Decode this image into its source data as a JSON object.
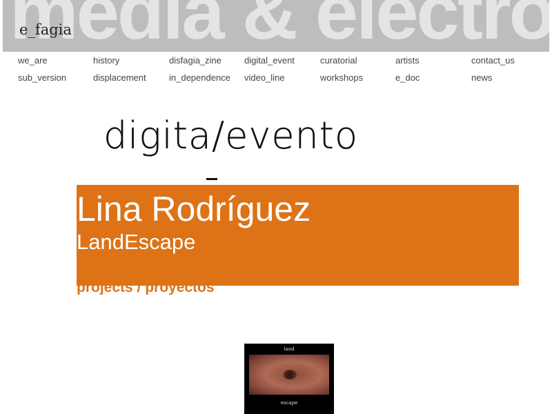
{
  "banner": {
    "background_text": "media & electronic",
    "logo": "e_fagia"
  },
  "nav": {
    "row1": [
      "we_are",
      "history",
      "disfagia_zine",
      "digital_event",
      "curatorial",
      "artists",
      "contact_us"
    ],
    "row2": [
      "sub_version",
      "displacement",
      "in_dependence",
      "video_line",
      "workshops",
      "e_doc",
      "news"
    ]
  },
  "section": {
    "title": "digita/evento"
  },
  "feature": {
    "artist": "Lina Rodríguez",
    "work": "LandEscape",
    "projects_label": "projects / proyectos",
    "accent_color": "#dd7316"
  },
  "thumbnail": {
    "top_text": "land",
    "bottom_text": "escape"
  }
}
